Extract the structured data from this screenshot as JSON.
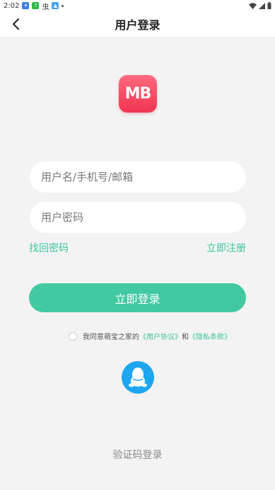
{
  "status_bar": {
    "time": "2:02",
    "notif_text": "虫"
  },
  "nav": {
    "title": "用户登录"
  },
  "logo": {
    "text": "MB"
  },
  "form": {
    "account_placeholder": "用户名/手机号/邮箱",
    "password_placeholder": "用户密码",
    "forgot_label": "找回密码",
    "register_label": "立即注册",
    "login_label": "立即登录"
  },
  "agreement": {
    "prefix": "我同意萌宝之家的",
    "user_agreement": "《用户协议》",
    "and": "和",
    "privacy_policy": "《隐私条款》"
  },
  "alt_login": {
    "code_login_label": "验证码登录"
  },
  "colors": {
    "accent": "#43c9a2",
    "link": "#3cc4a0",
    "logo": "#f0344f",
    "qq": "#1ea7f0",
    "background": "#f3f3f3"
  },
  "icons": {
    "back": "chevron-left-icon",
    "qq": "qq-penguin-icon",
    "wifi": "wifi-icon",
    "signal": "signal-icon",
    "battery": "battery-icon"
  }
}
